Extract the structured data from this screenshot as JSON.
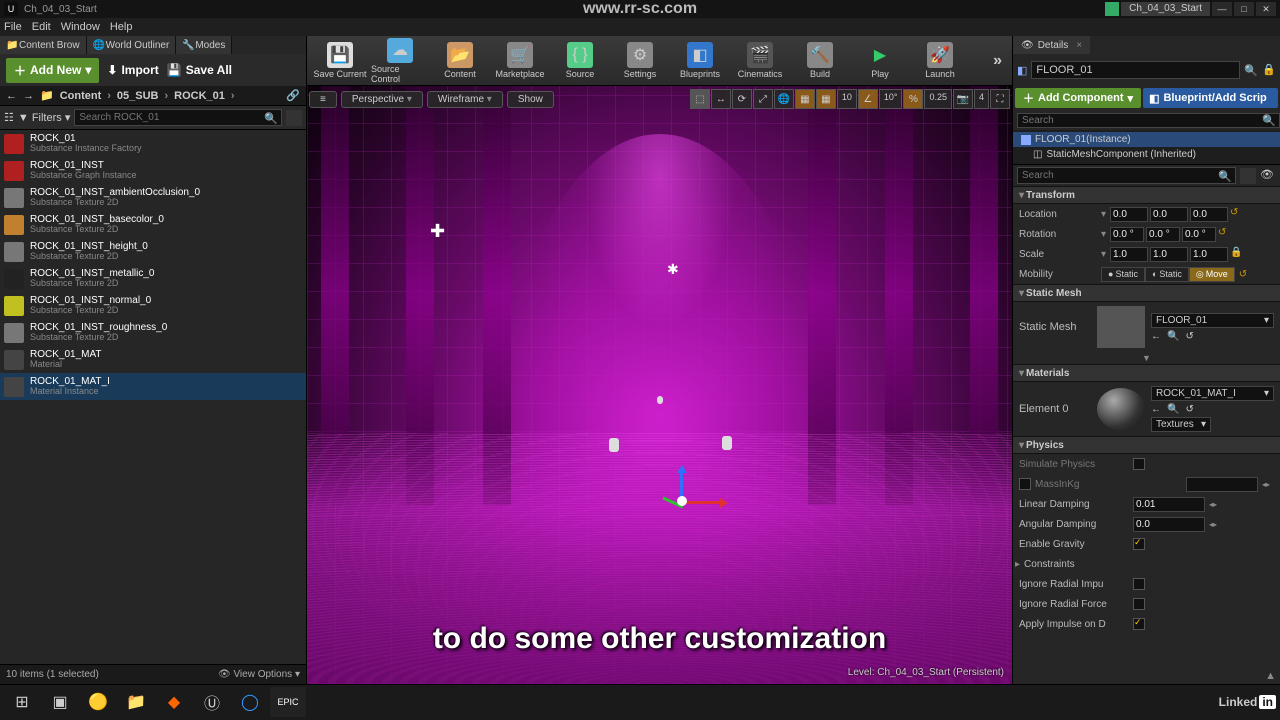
{
  "titlebar": {
    "project": "Ch_04_03_Start",
    "watermark": "www.rr-sc.com",
    "project_tab": "Ch_04_03_Start"
  },
  "menu": {
    "file": "File",
    "edit": "Edit",
    "window": "Window",
    "help": "Help"
  },
  "left_tabs": {
    "content": "Content Brow",
    "outliner": "World Outliner",
    "modes": "Modes"
  },
  "left_buttons": {
    "addnew": "Add New",
    "import": "Import",
    "saveall": "Save All"
  },
  "toolbar": {
    "save": "Save Current",
    "source_ctrl": "Source Control",
    "content": "Content",
    "market": "Marketplace",
    "source": "Source",
    "settings": "Settings",
    "blueprints": "Blueprints",
    "cine": "Cinematics",
    "build": "Build",
    "play": "Play",
    "launch": "Launch",
    "more": "»"
  },
  "details_tab": "Details",
  "details_crumb": "FLOOR_01",
  "add_component": "Add Component",
  "blueprint_add": "Blueprint/Add Scrip",
  "comp_tree": {
    "root": "FLOOR_01(Instance)",
    "child": "StaticMeshComponent (Inherited)"
  },
  "cb": {
    "nav_back": "←",
    "nav_fwd": "→",
    "path": [
      "Content",
      "05_SUB",
      "ROCK_01"
    ],
    "filter_label": "Filters",
    "search_placeholder": "Search ROCK_01",
    "items": [
      {
        "name": "ROCK_01",
        "type": "Substance Instance Factory",
        "thumb": "#b02020"
      },
      {
        "name": "ROCK_01_INST",
        "type": "Substance Graph Instance",
        "thumb": "#b02020"
      },
      {
        "name": "ROCK_01_INST_ambientOcclusion_0",
        "type": "Substance Texture 2D",
        "thumb": "#777"
      },
      {
        "name": "ROCK_01_INST_basecolor_0",
        "type": "Substance Texture 2D",
        "thumb": "#c08030"
      },
      {
        "name": "ROCK_01_INST_height_0",
        "type": "Substance Texture 2D",
        "thumb": "#777"
      },
      {
        "name": "ROCK_01_INST_metallic_0",
        "type": "Substance Texture 2D",
        "thumb": "#222"
      },
      {
        "name": "ROCK_01_INST_normal_0",
        "type": "Substance Texture 2D",
        "thumb": "#c0c020"
      },
      {
        "name": "ROCK_01_INST_roughness_0",
        "type": "Substance Texture 2D",
        "thumb": "#777"
      },
      {
        "name": "ROCK_01_MAT",
        "type": "Material",
        "thumb": "#444"
      },
      {
        "name": "ROCK_01_MAT_I",
        "type": "Material Instance",
        "thumb": "#444"
      }
    ],
    "status": "10 items (1 selected)",
    "view_options": "View Options"
  },
  "viewport": {
    "menu": "≡",
    "perspective": "Perspective",
    "wireframe": "Wireframe",
    "show": "Show",
    "snap": "10",
    "angle": "10°",
    "scale": "0.25",
    "cam": "4",
    "level_label": "Level: Ch_04_03_Start (Persistent)",
    "subtitle": "to do some other customization"
  },
  "sections": {
    "transform": "Transform",
    "staticmesh": "Static Mesh",
    "materials": "Materials",
    "physics": "Physics",
    "constraints": "Constraints"
  },
  "props": {
    "location": "Location",
    "rotation": "Rotation",
    "scale": "Scale",
    "mobility": "Mobility",
    "loc": [
      "0.0",
      "0.0",
      "0.0"
    ],
    "rot": [
      "0.0 °",
      "0.0 °",
      "0.0 °"
    ],
    "scl": [
      "1.0",
      "1.0",
      "1.0"
    ],
    "mob_opts": [
      "Static",
      "Static",
      "Move"
    ],
    "static_mesh_label": "Static Mesh",
    "static_mesh_value": "FLOOR_01",
    "element0": "Element 0",
    "mat_value": "ROCK_01_MAT_I",
    "textures": "Textures",
    "sim_physics": "Simulate Physics",
    "mass": "MassInKg",
    "lin_damp": "Linear Damping",
    "lin_damp_v": "0.01",
    "ang_damp": "Angular Damping",
    "ang_damp_v": "0.0",
    "enable_grav": "Enable Gravity",
    "ignore_imp": "Ignore Radial Impu",
    "ignore_force": "Ignore Radial Force",
    "apply_imp": "Apply Impulse on D"
  },
  "search_placeholder": "Search",
  "linkedin": "Linked"
}
